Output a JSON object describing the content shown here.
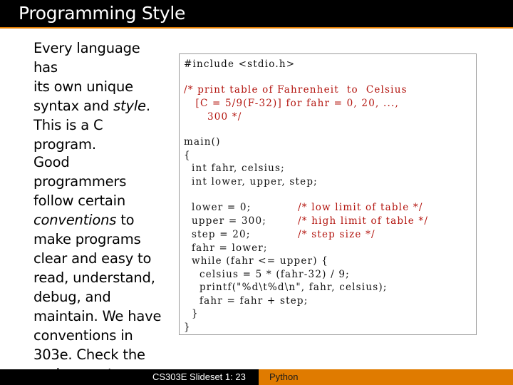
{
  "title": "Programming Style",
  "left": {
    "p1_lines": [
      [
        {
          "t": "Every language has"
        }
      ],
      [
        {
          "t": "its own unique"
        }
      ],
      [
        {
          "t": "syntax and "
        },
        {
          "t": "style",
          "i": true
        },
        {
          "t": "."
        }
      ],
      [
        {
          "t": "This is a C"
        }
      ],
      [
        {
          "t": "program."
        }
      ]
    ],
    "p2_lines": [
      [
        {
          "t": "Good programmers"
        }
      ],
      [
        {
          "t": "follow certain"
        }
      ],
      [
        {
          "t": "conventions",
          "i": true
        },
        {
          "t": " to"
        }
      ],
      [
        {
          "t": "make programs"
        }
      ],
      [
        {
          "t": "clear and easy to"
        }
      ],
      [
        {
          "t": "read, understand,"
        }
      ],
      [
        {
          "t": "debug, and"
        }
      ],
      [
        {
          "t": "maintain. We have"
        }
      ],
      [
        {
          "t": "conventions in"
        }
      ],
      [
        {
          "t": "303e. Check the"
        }
      ],
      [
        {
          "t": "assignment page."
        }
      ]
    ]
  },
  "code": {
    "lines": [
      {
        "text": "#include <stdio.h>",
        "color": "black"
      },
      {
        "text": "/* print table of Fahrenheit  to  Celsius",
        "color": "red"
      },
      {
        "text": "   [C = 5/9(F-32)] for fahr = 0, 20, ...,",
        "color": "red"
      },
      {
        "text": "      300 */",
        "color": "red"
      },
      {
        "text": "main()",
        "color": "black"
      },
      {
        "text": "{",
        "color": "black"
      },
      {
        "text": "  int fahr, celsius;",
        "color": "black"
      },
      {
        "text": "  int lower, upper, step;",
        "color": "black"
      },
      {
        "text": "  lower = 0;",
        "color": "black"
      },
      {
        "text": "/* low limit of table */",
        "color": "red"
      },
      {
        "text": "  upper = 300;",
        "color": "black"
      },
      {
        "text": "/* high limit of table */",
        "color": "red"
      },
      {
        "text": "  step = 20;",
        "color": "black"
      },
      {
        "text": "/* step size */",
        "color": "red"
      },
      {
        "text": "  fahr = lower;",
        "color": "black"
      },
      {
        "text": "  while (fahr <= upper) {",
        "color": "black"
      },
      {
        "text": "    celsius = 5 * (fahr-32) / 9;",
        "color": "black"
      },
      {
        "text": "    printf(\"%d\\t%d\\n\", fahr, celsius);",
        "color": "black"
      },
      {
        "text": "    fahr = fahr + step;",
        "color": "black"
      },
      {
        "text": "  }",
        "color": "black"
      },
      {
        "text": "}",
        "color": "black"
      }
    ]
  },
  "footer": {
    "slide": "CS303E Slideset 1: 23",
    "topic": "Python"
  }
}
